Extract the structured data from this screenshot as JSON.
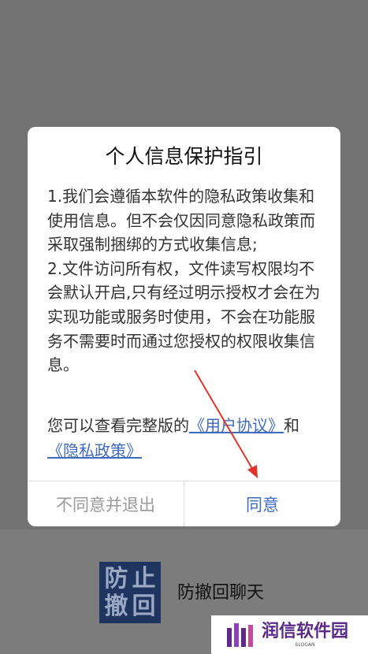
{
  "app": {
    "logo_chars": [
      "防",
      "止",
      "撤",
      "回"
    ],
    "name": "防撤回聊天"
  },
  "dialog": {
    "title": "个人信息保护指引",
    "paragraph1": "1.我们会遵循本软件的隐私政策收集和使用信息。但不会仅因同意隐私政策而采取强制捆绑的方式收集信息;",
    "paragraph2": "2.文件访问所有权，文件读写权限均不会默认开启,只有经过明示授权才会在为实现功能或服务时使用，不会在功能服务不需要时而通过您授权的权限收集信息。",
    "links_prefix": "您可以查看完整版的",
    "user_agreement_link": "《用户协议》",
    "links_and": "和",
    "privacy_policy_link": "《隐私政策》",
    "decline_label": "不同意并退出",
    "agree_label": "同意"
  },
  "watermark": {
    "text": "润信软件园",
    "slogan": "SLOGAN"
  },
  "colors": {
    "overlay": "#727272",
    "link": "#3f6bc0",
    "arrow": "#e0332b",
    "logo_bg": "#1f3560",
    "watermark_text": "#5b2a8a"
  }
}
